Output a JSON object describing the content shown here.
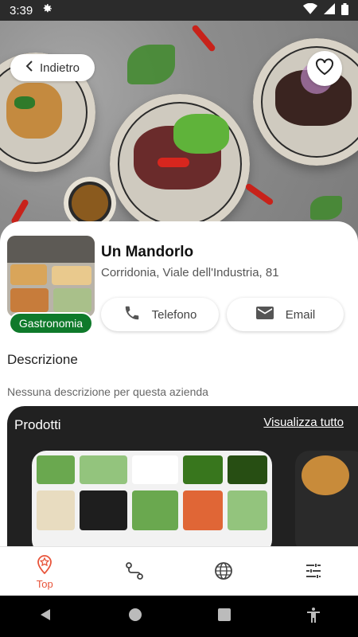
{
  "status_bar": {
    "time": "3:39",
    "icons": [
      "settings-gear-icon",
      "wifi-icon",
      "signal-icon",
      "battery-icon"
    ]
  },
  "header": {
    "back_label": "Indietro",
    "favorite_icon": "heart-outline-icon"
  },
  "business": {
    "name": "Un Mandorlo",
    "address": "Corridonia, Viale dell'Industria, 81",
    "category_badge": "Gastronomia",
    "phone_label": "Telefono",
    "email_label": "Email"
  },
  "description": {
    "heading": "Descrizione",
    "text": "Nessuna descrizione per questa azienda"
  },
  "products": {
    "heading": "Prodotti",
    "view_all": "Visualizza tutto"
  },
  "bottom_nav": {
    "items": [
      {
        "label": "Top",
        "icon": "star-pin-icon",
        "active": true
      },
      {
        "label": "",
        "icon": "route-icon",
        "active": false
      },
      {
        "label": "",
        "icon": "globe-icon",
        "active": false
      },
      {
        "label": "",
        "icon": "sliders-icon",
        "active": false
      }
    ]
  },
  "colors": {
    "accent": "#e8543a",
    "badge": "#0f7a2b",
    "products_bg": "#212121"
  }
}
